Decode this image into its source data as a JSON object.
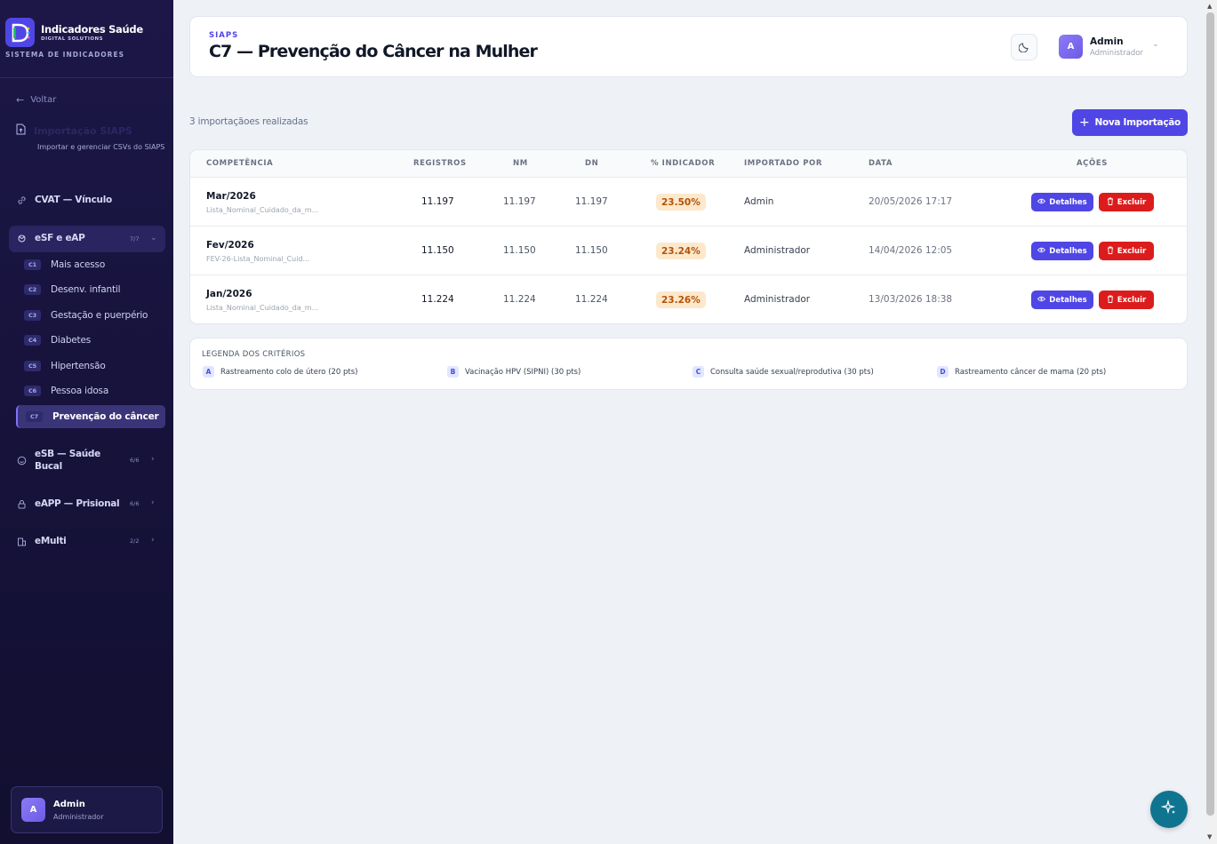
{
  "sidebar": {
    "brand_title": "Indicadores Saúde",
    "brand_subtitle": "DIGITAL SOLUTIONS",
    "system_label": "SISTEMA DE INDICADORES",
    "back_label": "Voltar",
    "import": {
      "title": "Importação SIAPS",
      "subtitle": "Importar e gerenciar CSVs do SIAPS"
    },
    "cvat_label": "CVAT — Vínculo",
    "esf_group": {
      "label": "eSF e eAP",
      "count": "7/7"
    },
    "esf_items": [
      {
        "code": "C1",
        "label": "Mais acesso"
      },
      {
        "code": "C2",
        "label": "Desenv. infantil"
      },
      {
        "code": "C3",
        "label": "Gestação e puerpério"
      },
      {
        "code": "C4",
        "label": "Diabetes"
      },
      {
        "code": "C5",
        "label": "Hipertensão"
      },
      {
        "code": "C6",
        "label": "Pessoa idosa"
      },
      {
        "code": "C7",
        "label": "Prevenção do câncer"
      }
    ],
    "groups": [
      {
        "label": "eSB — Saúde Bucal",
        "count": "6/6",
        "icon": "smile-icon"
      },
      {
        "label": "eAPP — Prisional",
        "count": "6/6",
        "icon": "lock-icon"
      },
      {
        "label": "eMulti",
        "count": "2/2",
        "icon": "building-icon"
      }
    ],
    "user": {
      "initial": "A",
      "name": "Admin",
      "role": "Administrador"
    }
  },
  "header": {
    "breadcrumb": "SIAPS",
    "title": "C7 — Prevenção do Câncer na Mulher",
    "user": {
      "initial": "A",
      "name": "Admin",
      "role": "Administrador"
    }
  },
  "toolbar": {
    "count_text": "3 importaçãoes realizadas",
    "new_import_label": "Nova Importação"
  },
  "table": {
    "headers": [
      "COMPETÊNCIA",
      "REGISTROS",
      "NM",
      "DN",
      "% INDICADOR",
      "IMPORTADO POR",
      "DATA",
      "AÇÕES"
    ],
    "rows": [
      {
        "competencia": "Mar/2026",
        "arquivo": "Lista_Nominal_Cuidado_da_m...",
        "registros": "11.197",
        "nm": "11.197",
        "dn": "11.197",
        "indicador": "23.50%",
        "importado_por": "Admin",
        "data": "20/05/2026 17:17"
      },
      {
        "competencia": "Fev/2026",
        "arquivo": "FEV-26-Lista_Nominal_Cuid...",
        "registros": "11.150",
        "nm": "11.150",
        "dn": "11.150",
        "indicador": "23.24%",
        "importado_por": "Administrador",
        "data": "14/04/2026 12:05"
      },
      {
        "competencia": "Jan/2026",
        "arquivo": "Lista_Nominal_Cuidado_da_m...",
        "registros": "11.224",
        "nm": "11.224",
        "dn": "11.224",
        "indicador": "23.26%",
        "importado_por": "Administrador",
        "data": "13/03/2026 18:38"
      }
    ],
    "actions": {
      "details_label": "Detalhes",
      "delete_label": "Excluir"
    }
  },
  "legend": {
    "title": "LEGENDA DOS CRITÉRIOS",
    "items": [
      {
        "key": "A",
        "label": "Rastreamento colo de útero (20 pts)"
      },
      {
        "key": "B",
        "label": "Vacinação HPV (SIPNI) (30 pts)"
      },
      {
        "key": "C",
        "label": "Consulta saúde sexual/reprodutiva (30 pts)"
      },
      {
        "key": "D",
        "label": "Rastreamento câncer de mama (20 pts)"
      }
    ]
  },
  "colors": {
    "accent": "#4f46e5",
    "danger": "#dc1c1c",
    "sidebar_bg": "#1c1747",
    "badge_bg": "#fde8cc",
    "badge_text": "#b45309",
    "fab": "#0e7490"
  }
}
